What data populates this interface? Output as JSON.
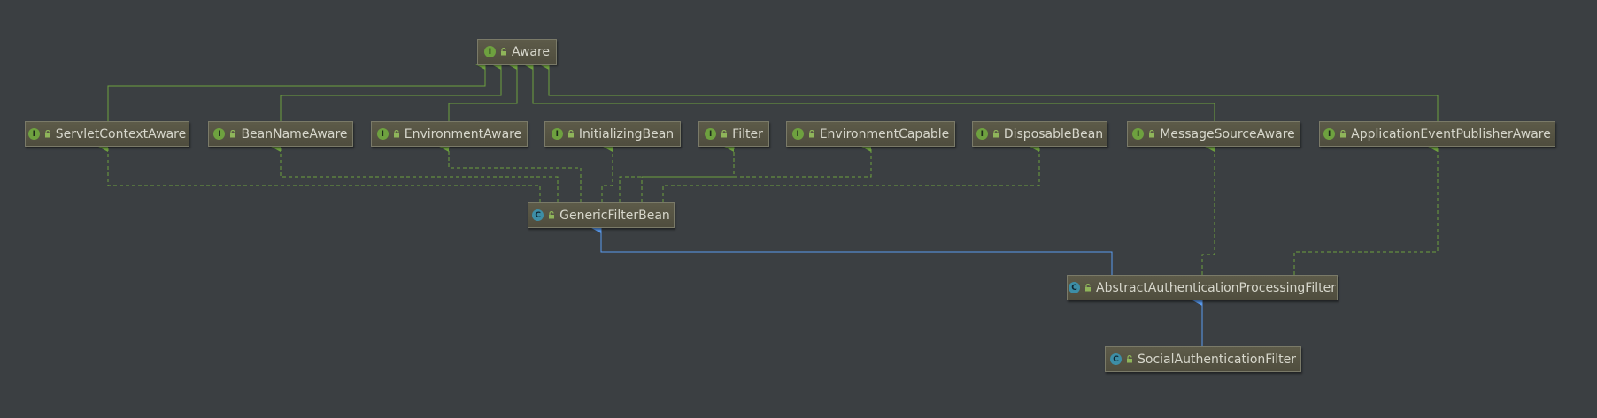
{
  "diagram": {
    "colors": {
      "background": "#3b3f42",
      "implements_edge": "#6ea13f",
      "extends_edge": "#5a9bef",
      "interface_badge": "#6ea13f",
      "class_badge": "#3d8ea6"
    },
    "kind_badges": {
      "interface": "I",
      "class": "C"
    },
    "nodes": [
      {
        "id": "aware",
        "label": "Aware",
        "kind": "interface"
      },
      {
        "id": "servlet_context_aware",
        "label": "ServletContextAware",
        "kind": "interface"
      },
      {
        "id": "bean_name_aware",
        "label": "BeanNameAware",
        "kind": "interface"
      },
      {
        "id": "environment_aware",
        "label": "EnvironmentAware",
        "kind": "interface"
      },
      {
        "id": "initializing_bean",
        "label": "InitializingBean",
        "kind": "interface"
      },
      {
        "id": "filter",
        "label": "Filter",
        "kind": "interface"
      },
      {
        "id": "environment_capable",
        "label": "EnvironmentCapable",
        "kind": "interface"
      },
      {
        "id": "disposable_bean",
        "label": "DisposableBean",
        "kind": "interface"
      },
      {
        "id": "message_source_aware",
        "label": "MessageSourceAware",
        "kind": "interface"
      },
      {
        "id": "application_event_publisher_aware",
        "label": "ApplicationEventPublisherAware",
        "kind": "interface"
      },
      {
        "id": "generic_filter_bean",
        "label": "GenericFilterBean",
        "kind": "class"
      },
      {
        "id": "abstract_authentication_processing_filter",
        "label": "AbstractAuthenticationProcessingFilter",
        "kind": "class"
      },
      {
        "id": "social_authentication_filter",
        "label": "SocialAuthenticationFilter",
        "kind": "class"
      }
    ],
    "edges": [
      {
        "from": "servlet_context_aware",
        "to": "aware",
        "type": "extends"
      },
      {
        "from": "bean_name_aware",
        "to": "aware",
        "type": "extends"
      },
      {
        "from": "environment_aware",
        "to": "aware",
        "type": "extends"
      },
      {
        "from": "message_source_aware",
        "to": "aware",
        "type": "extends"
      },
      {
        "from": "application_event_publisher_aware",
        "to": "aware",
        "type": "extends"
      },
      {
        "from": "generic_filter_bean",
        "to": "servlet_context_aware",
        "type": "implements"
      },
      {
        "from": "generic_filter_bean",
        "to": "bean_name_aware",
        "type": "implements"
      },
      {
        "from": "generic_filter_bean",
        "to": "environment_aware",
        "type": "implements"
      },
      {
        "from": "generic_filter_bean",
        "to": "initializing_bean",
        "type": "implements"
      },
      {
        "from": "generic_filter_bean",
        "to": "filter",
        "type": "implements"
      },
      {
        "from": "generic_filter_bean",
        "to": "environment_capable",
        "type": "implements"
      },
      {
        "from": "generic_filter_bean",
        "to": "disposable_bean",
        "type": "implements"
      },
      {
        "from": "abstract_authentication_processing_filter",
        "to": "generic_filter_bean",
        "type": "class_extends"
      },
      {
        "from": "abstract_authentication_processing_filter",
        "to": "message_source_aware",
        "type": "implements"
      },
      {
        "from": "abstract_authentication_processing_filter",
        "to": "application_event_publisher_aware",
        "type": "implements"
      },
      {
        "from": "social_authentication_filter",
        "to": "abstract_authentication_processing_filter",
        "type": "class_extends"
      }
    ]
  }
}
